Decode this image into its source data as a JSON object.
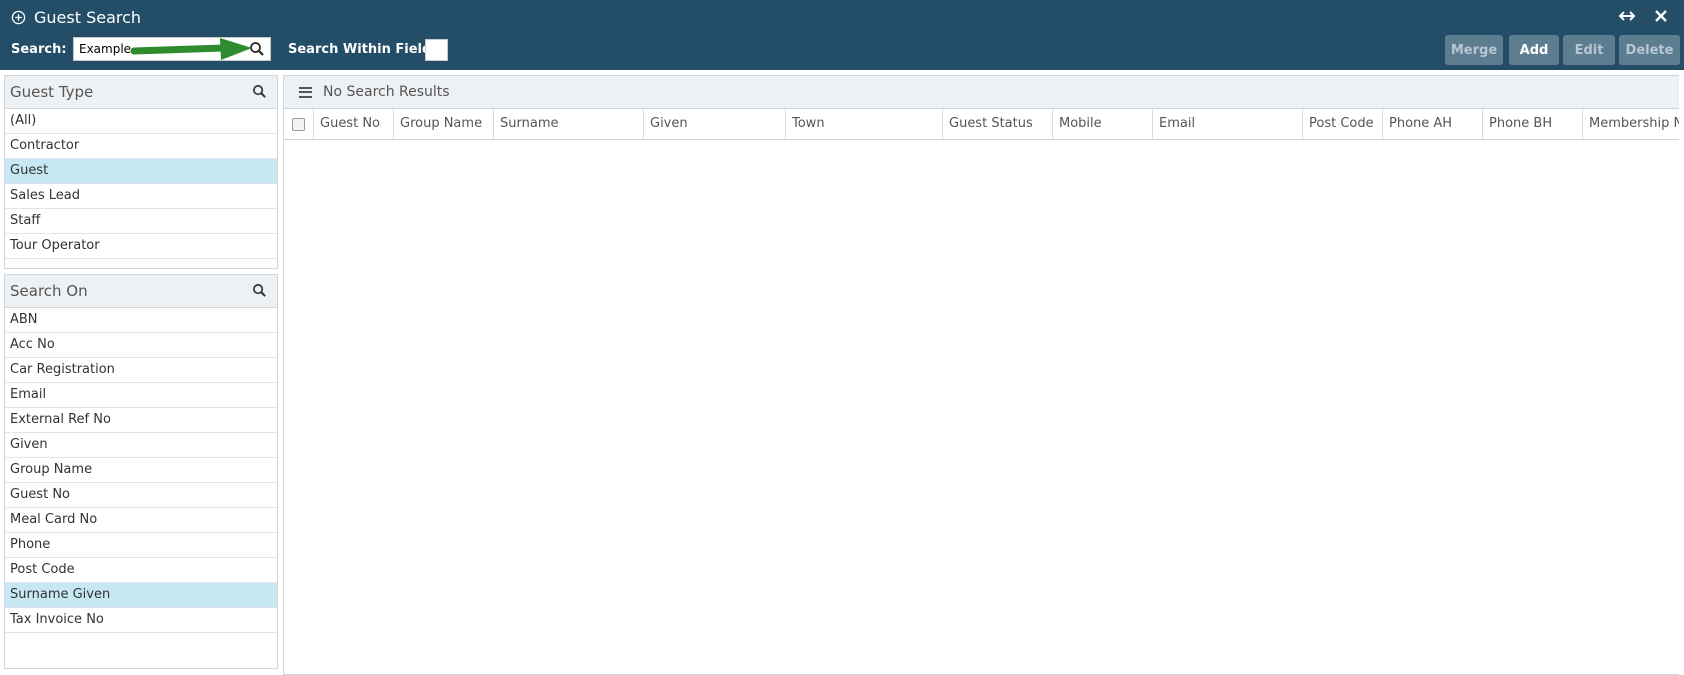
{
  "window": {
    "title": "Guest Search"
  },
  "toolbar": {
    "search_label": "Search:",
    "search_value": "Example",
    "within_label": "Search Within Field:",
    "buttons": {
      "merge": "Merge",
      "add": "Add",
      "edit": "Edit",
      "delete": "Delete"
    }
  },
  "guest_type": {
    "title": "Guest Type",
    "items": [
      "(All)",
      "Contractor",
      "Guest",
      "Sales Lead",
      "Staff",
      "Tour Operator"
    ],
    "selected": "Guest"
  },
  "search_on": {
    "title": "Search On",
    "items": [
      "ABN",
      "Acc No",
      "Car Registration",
      "Email",
      "External Ref No",
      "Given",
      "Group Name",
      "Guest No",
      "Meal Card No",
      "Phone",
      "Post Code",
      "Surname Given",
      "Tax Invoice No"
    ],
    "selected": "Surname Given"
  },
  "results": {
    "title": "No Search Results",
    "columns": [
      "Guest No",
      "Group Name",
      "Surname",
      "Given",
      "Town",
      "Guest Status",
      "Mobile",
      "Email",
      "Post Code",
      "Phone AH",
      "Phone BH",
      "Membership N"
    ]
  },
  "colors": {
    "header_bg": "#244e67",
    "button_bg": "#5d7d91",
    "selected_row": "#c5e8f3",
    "arrow": "#2e8b2e"
  }
}
